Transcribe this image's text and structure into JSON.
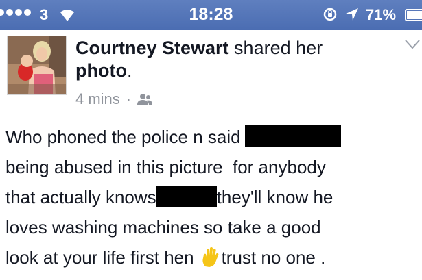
{
  "status_bar": {
    "carrier": "3",
    "time": "18:28",
    "battery_percent": "71%",
    "battery_level": 0.71,
    "signal_bars_filled": 4,
    "signal_bars_total": 5
  },
  "post": {
    "author": "Courtney Stewart",
    "story_suffix": " shared her ",
    "story_object": "photo",
    "story_period": ".",
    "time_ago": "4 mins",
    "separator": "·",
    "audience_icon": "friends-icon",
    "body": {
      "line1": "Who phoned the police n said",
      "line2": "being abused in this picture  for anybody",
      "line3_before": "that actually knows",
      "line3_after": "they'll know he",
      "line4": "loves washing machines so take a good",
      "line5_before": "look at your life first hen",
      "line5_after": "trust no one ."
    }
  },
  "colors": {
    "status_bar": "#4b6db2",
    "text": "#141823",
    "meta": "#90949c",
    "redaction": "#000000",
    "emoji_hand": "#f5c518"
  }
}
